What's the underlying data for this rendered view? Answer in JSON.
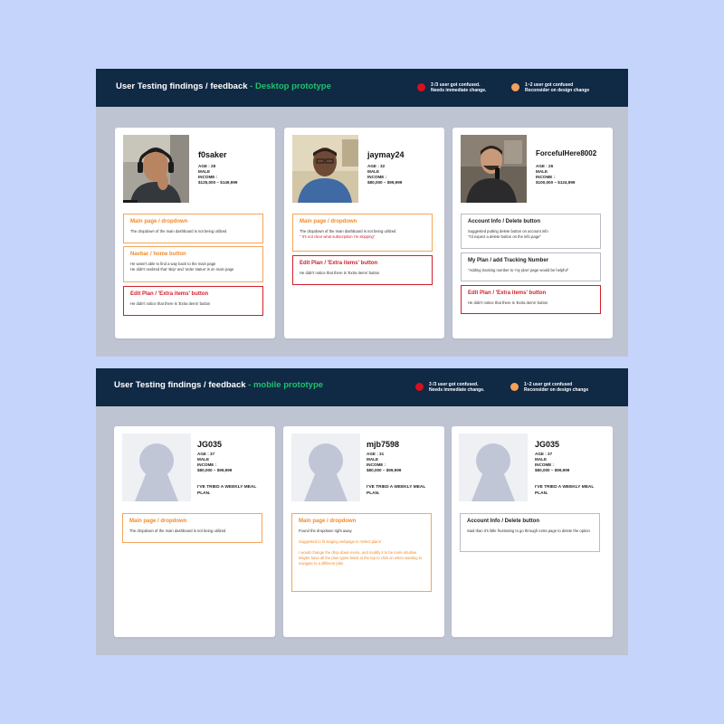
{
  "desktop": {
    "title": "User Testing findings / feedback",
    "title_accent": "- Desktop prototype",
    "legend": [
      {
        "color": "#d80f1f",
        "text": "3 /3 user got confused.\nNeeds immediate change."
      },
      {
        "color": "#f3a15a",
        "text": "1~2 user got confused\nReconsider on design change"
      }
    ],
    "cards": [
      {
        "name": "f0saker",
        "stats": [
          "AGE : 28",
          "MALE",
          "INCOME :",
          "$125,000 – $149,999"
        ],
        "findings": [
          {
            "severity": "orange",
            "title": "Main page / dropdown",
            "lines": [
              {
                "text": "The dropdown of the main dashboard is not being utilized",
                "style": ""
              }
            ]
          },
          {
            "severity": "orange",
            "title": "Navbar / home button",
            "lines": [
              {
                "text": "He wasn't able to find a way back to the main page",
                "style": ""
              },
              {
                "text": "He didn't realized that 'skip' and 'order status' is on main page",
                "style": ""
              }
            ]
          },
          {
            "severity": "red",
            "title": "Edit Plan / 'Extra items' button",
            "lines": [
              {
                "text": "He didn't notice that there is 'Extra items' button",
                "style": ""
              }
            ]
          }
        ]
      },
      {
        "name": "jaymay24",
        "stats": [
          "AGE : 32",
          "MALE",
          "INCOME :",
          "$80,000 – $99,999"
        ],
        "findings": [
          {
            "severity": "orange",
            "title": "Main page / dropdown",
            "lines": [
              {
                "text": "The dropdown of the main dashboard is not being utilized",
                "style": ""
              },
              {
                "text": "\" It's not clear what subscription I'm skipping\"",
                "style": "hl-red"
              }
            ]
          },
          {
            "severity": "red",
            "title": "Edit Plan / 'Extra items' button",
            "lines": [
              {
                "text": "He didn't notice that there is 'Extra items' button",
                "style": ""
              }
            ]
          }
        ]
      },
      {
        "name": "ForcefulHere8002",
        "stats": [
          "AGE : 26",
          "MALE",
          "INCOME :",
          "$100,000 – $124,999"
        ],
        "findings": [
          {
            "severity": "gray",
            "title": "Account Info / Delete button",
            "lines": [
              {
                "text": "Suggested putting delete button on account info",
                "style": ""
              },
              {
                "text": "\"I'd expect a delete button on the info page\"",
                "style": ""
              }
            ]
          },
          {
            "severity": "gray",
            "title": "My Plan / add Tracking Number",
            "lines": [
              {
                "text": "\"Adding tracking number to 'my plan' page would be helpful\"",
                "style": ""
              }
            ]
          },
          {
            "severity": "red",
            "title": "Edit Plan / 'Extra items' button",
            "lines": [
              {
                "text": "He didn't notice that there is 'Extra items' button",
                "style": ""
              }
            ]
          }
        ]
      }
    ]
  },
  "mobile": {
    "title": "User Testing findings / feedback",
    "title_accent": "- mobile prototype",
    "legend": [
      {
        "color": "#d80f1f",
        "text": "3 /3 user got confused.\nNeeds immediate change."
      },
      {
        "color": "#f3a15a",
        "text": "1~2 user got confused\nReconsider on design change"
      }
    ],
    "cards": [
      {
        "name": "JG035",
        "stats": [
          "AGE : 37",
          "MALE",
          "INCOME :",
          "$80,000 – $99,999"
        ],
        "quote": "I'VE TRIED A WEEKLY MEAL PLAN.",
        "findings": [
          {
            "severity": "orange",
            "title": "Main page / dropdown",
            "lines": [
              {
                "text": "The dropdown of the main dashboard is not being utilized",
                "style": ""
              }
            ]
          }
        ]
      },
      {
        "name": "mjb7598",
        "stats": [
          "AGE : 31",
          "MALE",
          "INCOME :",
          "$80,000 – $99,999"
        ],
        "quote": "I'VE TRIED A WEEKLY MEAL PLAN.",
        "findings": [
          {
            "severity": "orange",
            "title": "Main page / dropdown",
            "lines": [
              {
                "text": "Found the dropdown right away",
                "style": ""
              },
              {
                "text": "",
                "style": ""
              },
              {
                "text": "Suggested to fit staging webpage to 'select plans'",
                "style": "hl-orange"
              },
              {
                "text": "",
                "style": ""
              },
              {
                "text": "I would change the drop down menu, and modify it to be more intuitive. Maybe have all the plan types listed at the top to click on when wanting to navigate to a different plan",
                "style": "hl-orange"
              }
            ]
          }
        ]
      },
      {
        "name": "JG035",
        "stats": [
          "AGE : 37",
          "MALE",
          "INCOME :",
          "$80,000 – $99,999"
        ],
        "quote": "I'VE TRIED A WEEKLY MEAL PLAN.",
        "findings": [
          {
            "severity": "gray",
            "title": "Account Info / Delete button",
            "lines": [
              {
                "text": "Said than it's little frustrating to go through extra page to delete the option",
                "style": ""
              }
            ]
          }
        ]
      }
    ]
  }
}
